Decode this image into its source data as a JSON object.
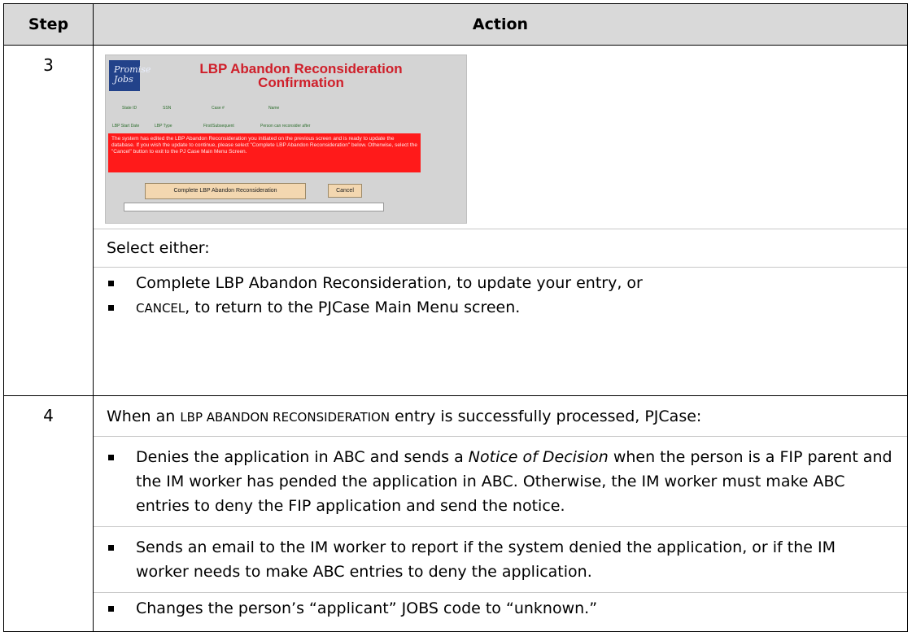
{
  "table": {
    "header": {
      "step": "Step",
      "action": "Action"
    },
    "rows": [
      {
        "step": "3",
        "screenshot": {
          "logo_text": "Promise Jobs",
          "title_line1": "LBP Abandon Reconsideration",
          "title_line2": "Confirmation",
          "fields_row1": [
            "State ID",
            "SSN",
            "Case #",
            "Name"
          ],
          "fields_row2": [
            "LBP Start Date",
            "LBP Type",
            "First/Subsequent",
            "Person can reconsider after"
          ],
          "message": "The system has edited the LBP Abandon Reconsideration you initiated on the previous screen and is ready to update the database. If you wish the update to continue, please select \"Complete LBP Abandon Reconsideration\" below. Otherwise, select the \"Cancel\" button to exit to the PJ Case Main Menu Screen.",
          "complete_button": "Complete LBP Abandon Reconsideration",
          "cancel_button": "Cancel"
        },
        "select_label": "Select either:",
        "bullet1": "Complete LBP Abandon Reconsideration, to update your entry, or",
        "bullet2_sc": "CANCEL",
        "bullet2_rest": ", to return to the PJCase Main Menu screen."
      },
      {
        "step": "4",
        "intro_pre": "When an ",
        "intro_sc": "LBP ABANDON RECONSIDERATION",
        "intro_post": " entry is successfully processed, PJCase:",
        "bullet1_pre": "Denies the application in ABC and sends a ",
        "bullet1_italic": "Notice of Decision",
        "bullet1_post": " when the person is a FIP parent and the IM worker has pended the application in ABC. Otherwise, the IM worker must make ABC entries to deny the FIP application and send the notice.",
        "bullet2": "Sends an email to the IM worker to report if the system denied the application, or if the IM worker needs to make ABC entries to deny the application.",
        "bullet3": "Changes the person’s “applicant” JOBS code to “unknown.”"
      }
    ]
  },
  "colors": {
    "header_bg": "#d9d9d9",
    "shot_title": "#cf1f2a",
    "shot_message_bg": "#ff1a1a",
    "button_bg": "#f3d7b0"
  }
}
